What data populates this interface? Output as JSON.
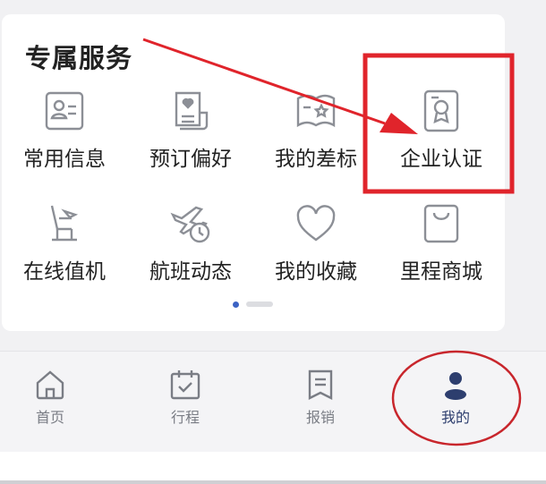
{
  "section": {
    "title": "专属服务",
    "items": [
      {
        "label": "常用信息",
        "icon": "id-card-icon"
      },
      {
        "label": "预订偏好",
        "icon": "preference-doc-icon"
      },
      {
        "label": "我的差标",
        "icon": "travel-standard-book-icon"
      },
      {
        "label": "企业认证",
        "icon": "certificate-icon"
      },
      {
        "label": "在线值机",
        "icon": "seat-checkin-icon"
      },
      {
        "label": "航班动态",
        "icon": "plane-clock-icon"
      },
      {
        "label": "我的收藏",
        "icon": "heart-icon"
      },
      {
        "label": "里程商城",
        "icon": "shopping-bag-icon"
      }
    ],
    "pager": {
      "pages": 2,
      "current": 1
    }
  },
  "tabbar": {
    "tabs": [
      {
        "label": "首页",
        "icon": "home-icon"
      },
      {
        "label": "行程",
        "icon": "calendar-check-icon"
      },
      {
        "label": "报销",
        "icon": "receipt-icon"
      },
      {
        "label": "我的",
        "icon": "user-icon",
        "active": true
      }
    ]
  },
  "annotations": {
    "highlight_color": "#e0242b",
    "ellipse_color": "#c8262c"
  },
  "colors": {
    "accent": "#2d3e6e",
    "icon_gray": "#8c8f96",
    "pager_active": "#3c63c4"
  }
}
